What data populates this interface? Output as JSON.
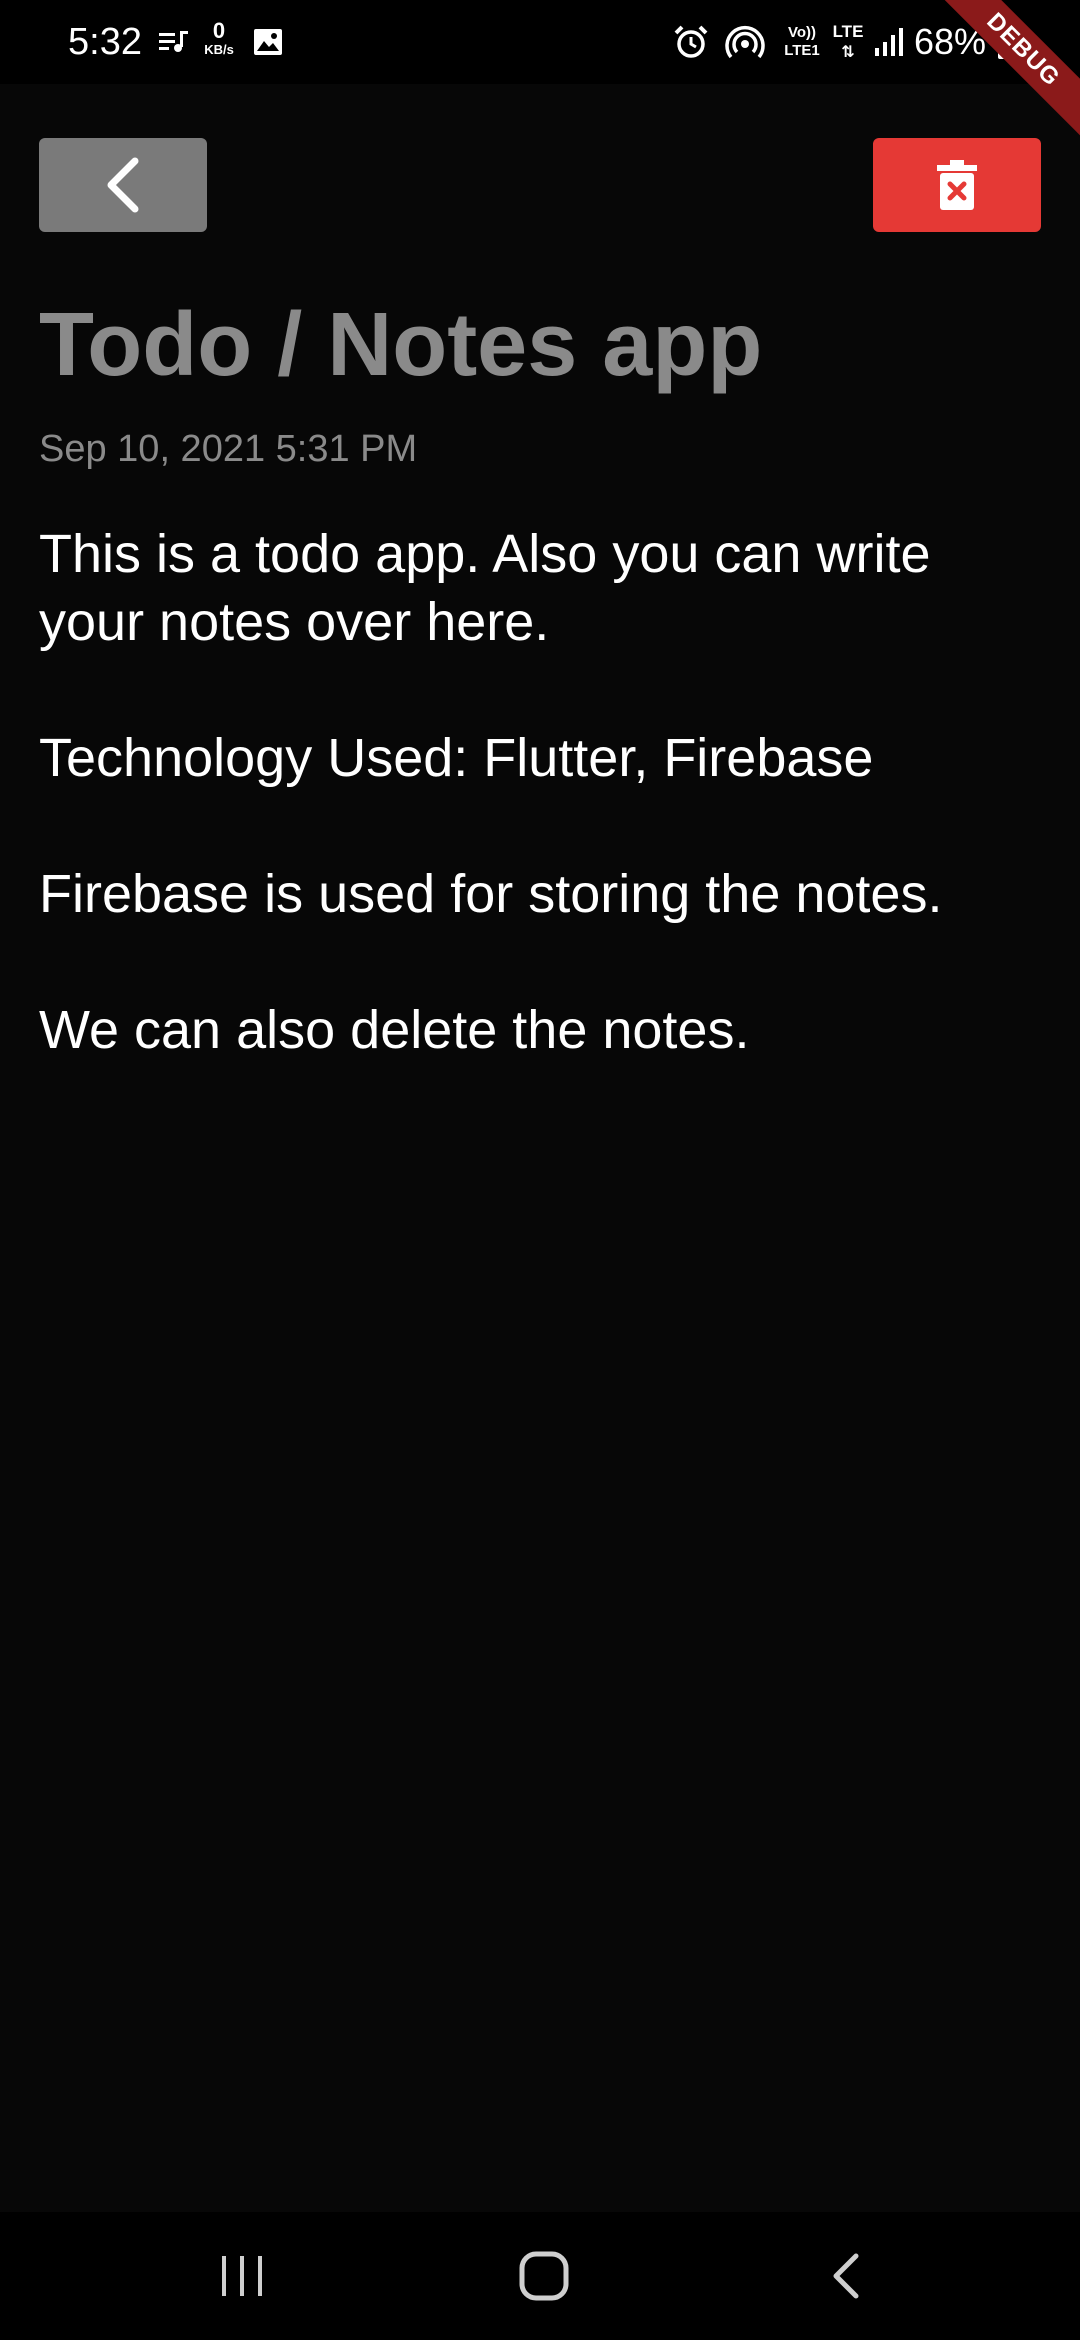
{
  "status_bar": {
    "time": "5:32",
    "net_speed_value": "0",
    "net_speed_unit": "KB/s",
    "volte_label_top": "Vo))",
    "volte_label_bottom": "LTE1",
    "lte_label": "LTE",
    "battery_percent": "68%",
    "icons": [
      "music-queue-icon",
      "image-icon",
      "alarm-icon",
      "hotspot-icon",
      "signal-icon",
      "battery-icon"
    ]
  },
  "debug_banner": "DEBUG",
  "toolbar": {
    "back_icon": "chevron-left-icon",
    "delete_icon": "delete-x-icon",
    "delete_color": "#e53935",
    "back_color": "#7a7a7a"
  },
  "note": {
    "title": "Todo / Notes app",
    "date": "Sep 10, 2021 5:31 PM",
    "body": "This is a todo app. Also you can write your notes over here.\n\nTechnology Used: Flutter, Firebase\n\nFirebase is used for storing the notes.\n\nWe can also delete the notes."
  },
  "nav_bar": {
    "icons": [
      "recents-icon",
      "home-icon",
      "back-icon"
    ]
  }
}
